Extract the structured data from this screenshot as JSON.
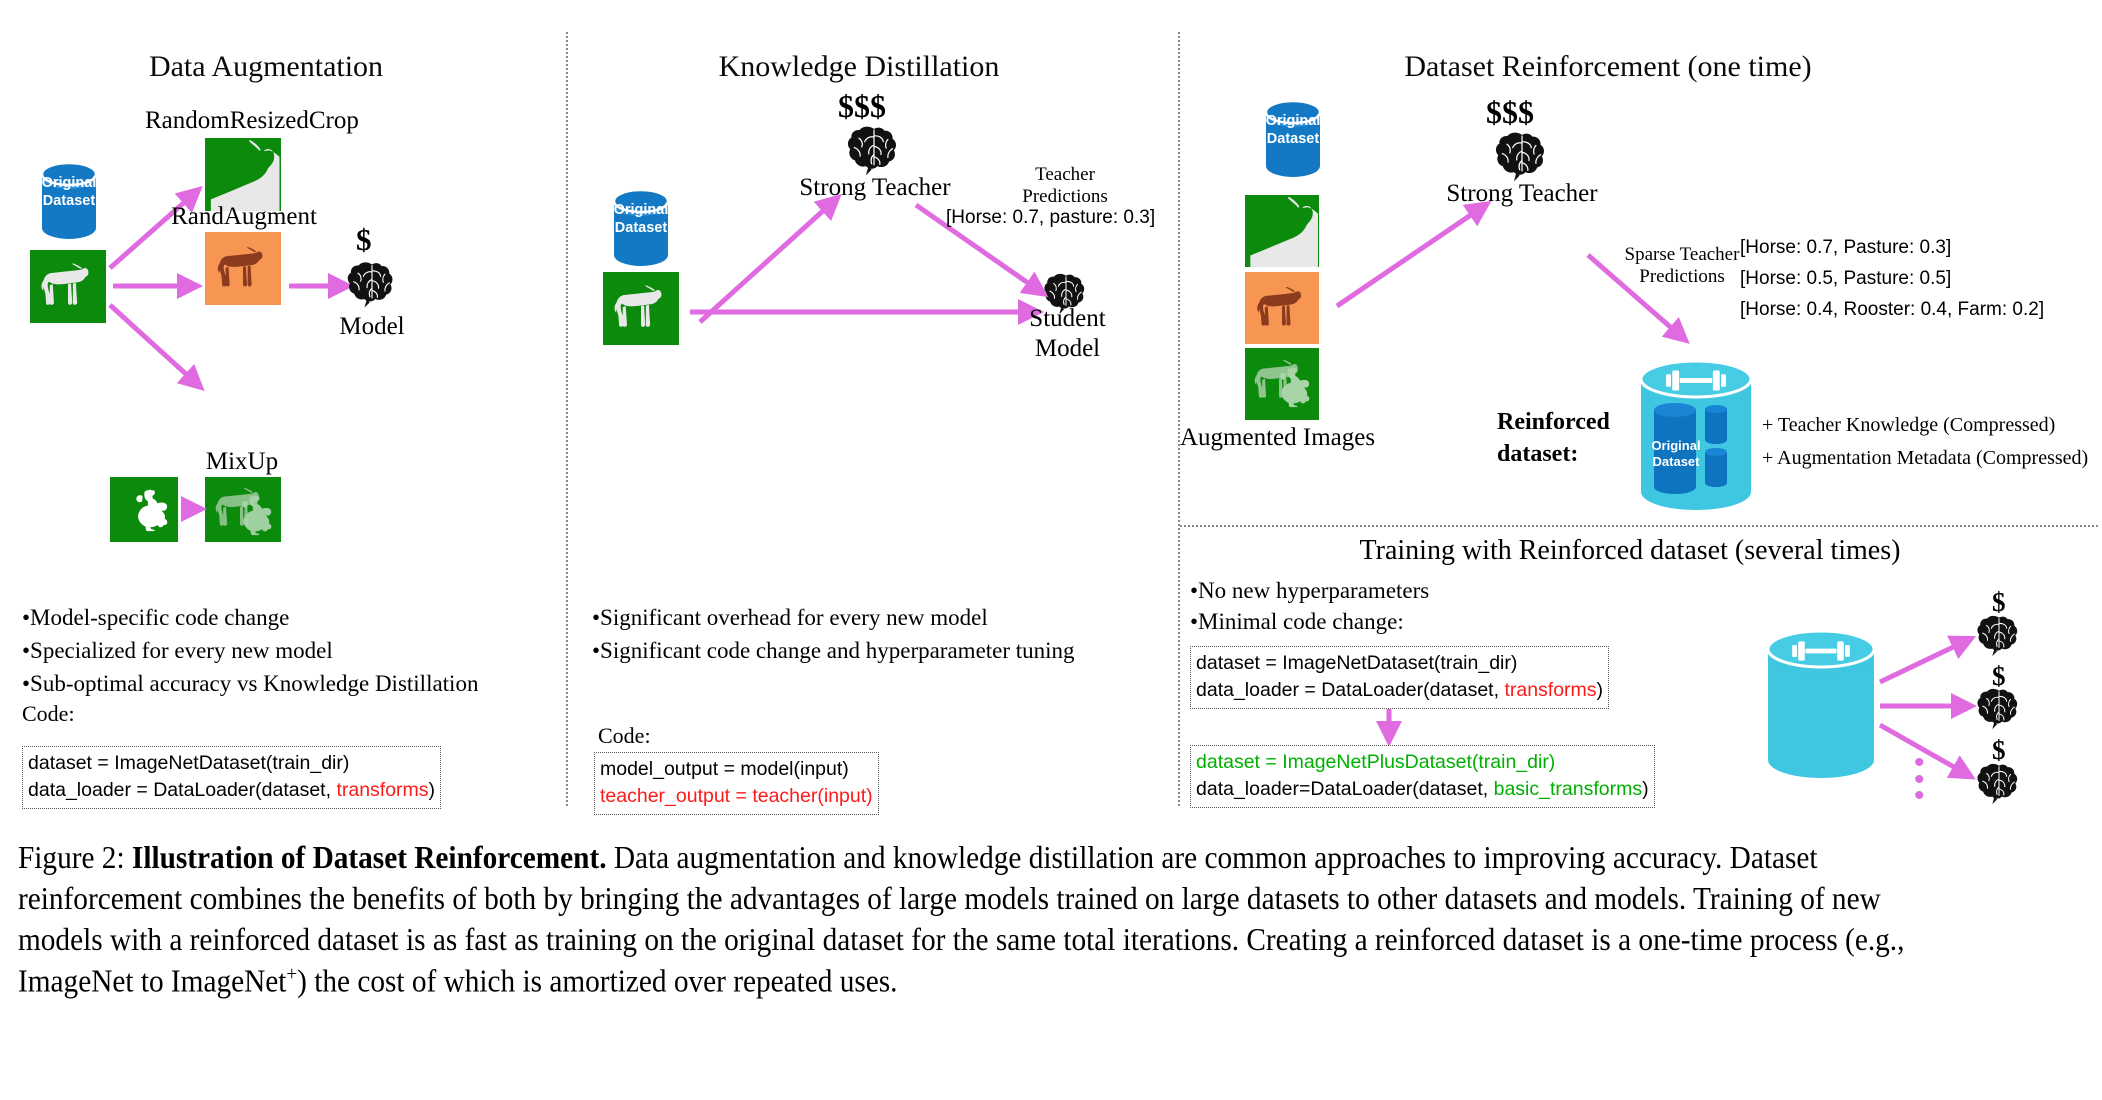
{
  "colors": {
    "green": "#0b8a0b",
    "orange": "#f79553",
    "blue": "#1479c4",
    "cyan": "#3fc6e0",
    "magenta": "#e06be0",
    "red": "#ff1a1a",
    "code_green": "#00b000"
  },
  "panels": {
    "data_augmentation": {
      "title": "Data Augmentation",
      "dataset_cylinder_label_line1": "Original",
      "dataset_cylinder_label_line2": "Dataset",
      "aug_labels": {
        "random_resized_crop": "RandomResizedCrop",
        "rand_augment": "RandAugment",
        "mixup": "MixUp"
      },
      "model_label": "Model",
      "model_cost": "$",
      "bullets": [
        "•Model-specific code change",
        "•Specialized for every new model",
        "•Sub-optimal accuracy vs Knowledge Distillation"
      ],
      "code_caption": "Code:",
      "code": {
        "line1": "dataset = ImageNetDataset(train_dir)",
        "line2_pre": "data_loader = DataLoader(dataset, ",
        "line2_hl": "transforms",
        "line2_post": ")"
      }
    },
    "knowledge_distillation": {
      "title": "Knowledge Distillation",
      "dataset_cylinder_label_line1": "Original",
      "dataset_cylinder_label_line2": "Dataset",
      "teacher_cost": "$$$",
      "teacher_label": "Strong Teacher",
      "teacher_predictions_line1": "Teacher",
      "teacher_predictions_line2": "Predictions",
      "teacher_prediction_value": "[Horse: 0.7, pasture: 0.3]",
      "student_label_line1": "Student",
      "student_label_line2": "Model",
      "bullets": [
        "•Significant overhead for every new model",
        "•Significant code change and hyperparameter tuning"
      ],
      "code_caption": "Code:",
      "code": {
        "line1": "model_output = model(input)",
        "line2": "teacher_output = teacher(input)"
      }
    },
    "dataset_reinforcement": {
      "title": "Dataset Reinforcement (one time)",
      "dataset_cylinder_label_line1": "Original",
      "dataset_cylinder_label_line2": "Dataset",
      "augmented_images_label": "Augmented Images",
      "teacher_cost": "$$$",
      "teacher_label": "Strong Teacher",
      "sparse_predictions_line1": "Sparse Teacher",
      "sparse_predictions_line2": "Predictions",
      "predictions": [
        "[Horse: 0.7, Pasture: 0.3]",
        "[Horse: 0.5, Pasture: 0.5]",
        "[Horse: 0.4, Rooster: 0.4, Farm: 0.2]"
      ],
      "reinforced_label_line1": "Reinforced",
      "reinforced_label_line2": "dataset:",
      "reinforced_cylinder_label_line1": "Original",
      "reinforced_cylinder_label_line2": "Dataset",
      "additions": [
        "+ Teacher Knowledge (Compressed)",
        "+ Augmentation Metadata (Compressed)"
      ]
    },
    "training_with_reinforced": {
      "title": "Training with Reinforced dataset (several times)",
      "bullets": [
        "•No new hyperparameters",
        "•Minimal code change:"
      ],
      "code_before": {
        "line1": "dataset = ImageNetDataset(train_dir)",
        "line2_pre": "data_loader = DataLoader(dataset, ",
        "line2_hl": "transforms",
        "line2_post": ")"
      },
      "code_after": {
        "line1": "dataset = ImageNetPlusDataset(train_dir)",
        "line2_pre": "data_loader=DataLoader(dataset, ",
        "line2_hl": "basic_transforms",
        "line2_post": ")"
      },
      "model_costs": [
        "$",
        "$",
        "$"
      ],
      "ellipsis": "⋮"
    }
  },
  "caption": {
    "figure_number": "Figure 2:",
    "bold_title": "Illustration of Dataset Reinforcement.",
    "body_part1": " Data augmentation and knowledge distillation are common approaches to improving accuracy. Dataset reinforcement combines the benefits of both by bringing the advantages of large models trained on large datasets to other datasets and models. Training of new models with a reinforced dataset is as fast as training on the original dataset for the same total iterations. Creating a reinforced dataset is a one-time process (e.g., ImageNet to ImageNet",
    "superscript": "+",
    "body_part2": ") the cost of which is amortized over repeated uses."
  }
}
